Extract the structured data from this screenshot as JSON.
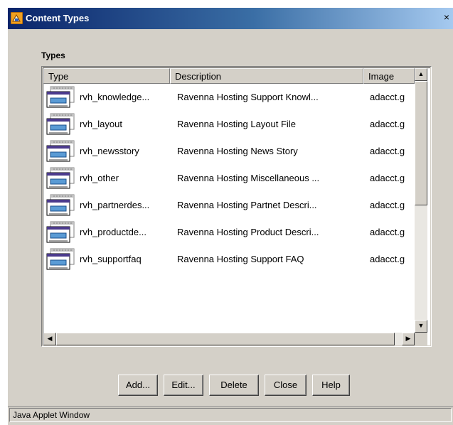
{
  "window": {
    "title": "Content Types",
    "close_glyph": "×"
  },
  "section_label": "Types",
  "table": {
    "columns": [
      "Type",
      "Description",
      "Image"
    ],
    "rows": [
      {
        "type": "rvh_knowledge...",
        "description": "Ravenna Hosting Support Knowl...",
        "image": "adacct.g",
        "icon": "content-type-icon"
      },
      {
        "type": "rvh_layout",
        "description": "Ravenna Hosting Layout File",
        "image": "adacct.g",
        "icon": "content-type-icon"
      },
      {
        "type": "rvh_newsstory",
        "description": "Ravenna Hosting News Story",
        "image": "adacct.g",
        "icon": "content-type-icon"
      },
      {
        "type": "rvh_other",
        "description": "Ravenna Hosting Miscellaneous ...",
        "image": "adacct.g",
        "icon": "content-type-icon"
      },
      {
        "type": "rvh_partnerdes...",
        "description": "Ravenna Hosting Partnet Descri...",
        "image": "adacct.g",
        "icon": "content-type-icon"
      },
      {
        "type": "rvh_productde...",
        "description": "Ravenna Hosting Product Descri...",
        "image": "adacct.g",
        "icon": "content-type-icon"
      },
      {
        "type": "rvh_supportfaq",
        "description": "Ravenna Hosting Support FAQ",
        "image": "adacct.g",
        "icon": "content-type-icon"
      }
    ]
  },
  "scrollbars": {
    "up": "▲",
    "down": "▼",
    "left": "◀",
    "right": "▶"
  },
  "buttons": {
    "add": "Add...",
    "edit": "Edit...",
    "delete": "Delete",
    "close": "Close",
    "help": "Help"
  },
  "status": "Java Applet Window",
  "colors": {
    "title_gradient_start": "#0a246a",
    "dialog_background": "#d4d0c8",
    "icon_accent": "#5a9bd5"
  }
}
